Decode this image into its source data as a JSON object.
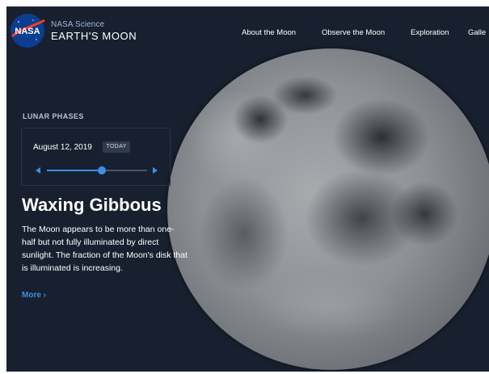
{
  "header": {
    "brand_top": "NASA Science",
    "brand_title": "EARTH'S MOON",
    "logo_text": "NASA",
    "nav": [
      {
        "label": "About the Moon"
      },
      {
        "label": "Observe the Moon"
      },
      {
        "label": "Exploration"
      },
      {
        "label": "Galle"
      }
    ]
  },
  "lunar_phases": {
    "section_label": "LUNAR PHASES",
    "date": "August 12, 2019",
    "today_label": "TODAY",
    "slider_position": 0.55,
    "phase_name": "Waxing Gibbous",
    "description": "The Moon appears to be more than one-half but not fully illuminated by direct sunlight. The fraction of the Moon's disk that is illuminated is increasing.",
    "more_label": "More ›"
  },
  "colors": {
    "background": "#18202f",
    "accent": "#3d8fe6",
    "text": "#ffffff"
  }
}
